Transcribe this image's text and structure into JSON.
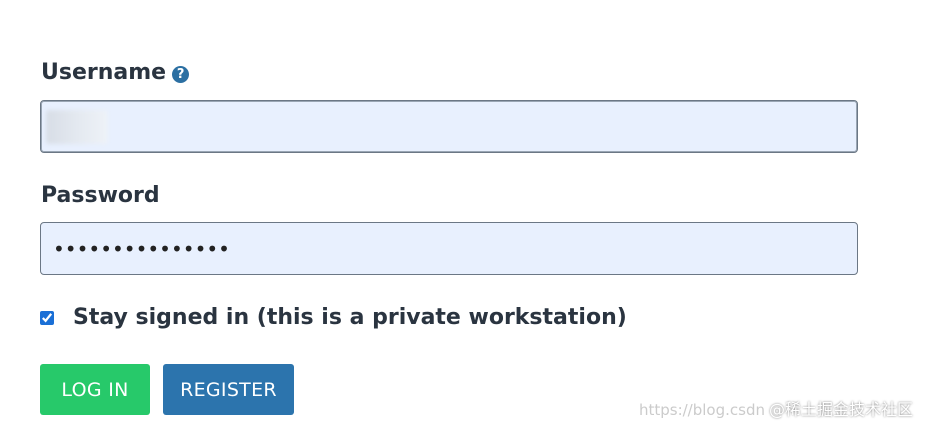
{
  "form": {
    "username_label": "Username",
    "username_help_glyph": "?",
    "username_value": "",
    "password_label": "Password",
    "password_value": "•••••••••••••••",
    "stay_signed_in_label": "Stay signed in (this is a private workstation)",
    "stay_signed_in_checked": true
  },
  "buttons": {
    "login_label": "LOG IN",
    "register_label": "REGISTER"
  },
  "watermark": {
    "url": "https://blog.csdn",
    "text": "@稀土掘金技术社区"
  },
  "icons": {
    "help": "question-circle-icon"
  },
  "colors": {
    "label_text": "#2a3440",
    "input_background": "#e8f0fe",
    "login_button": "#27c96a",
    "register_button": "#2c74ad",
    "help_icon": "#2b6fa2"
  }
}
